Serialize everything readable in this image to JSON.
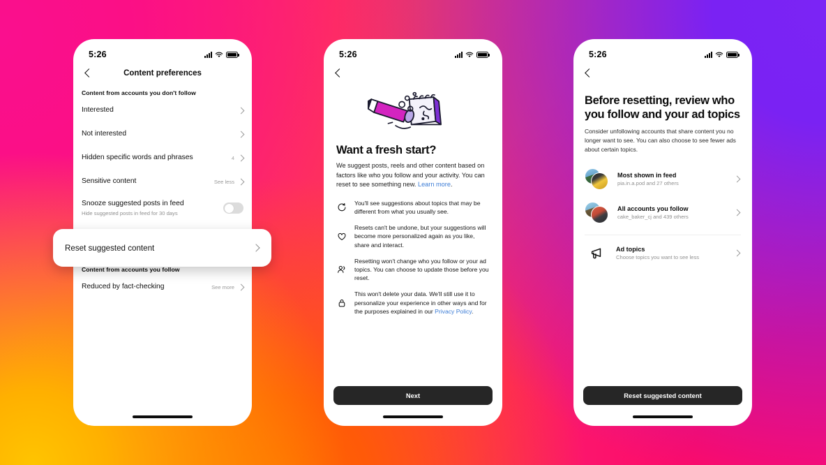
{
  "background": {
    "gradient_colors": [
      "#fa0f8e",
      "#7b24f5",
      "#ff0a6e",
      "#ff6a00",
      "#ffc400"
    ]
  },
  "phones": {
    "phone1": {
      "name": "content-preferences-screen",
      "status_bar": {
        "time": "5:26",
        "cellular": "cellular-icon",
        "wifi": "wifi-icon",
        "battery": "battery-icon"
      },
      "nav": {
        "back": "back-icon",
        "title": "Content preferences"
      },
      "section1_header": "Content from accounts you don't follow",
      "rows": [
        {
          "title": "Interested",
          "meta": "",
          "count": ""
        },
        {
          "title": "Not interested",
          "meta": "",
          "count": ""
        },
        {
          "title": "Hidden specific words and phrases",
          "meta": "",
          "count": "4"
        },
        {
          "title": "Sensitive content",
          "meta": "See less",
          "count": ""
        }
      ],
      "snooze": {
        "title": "Snooze suggested posts in feed",
        "subtitle": "Hide suggested posts in feed for 30 days",
        "toggle_state": "off"
      },
      "highlight": {
        "label": "Reset suggested content",
        "chevron": "chevron-right-icon"
      },
      "section2_header": "Content from accounts you follow",
      "rows2": [
        {
          "title": "Reduced by fact-checking",
          "meta": "See more",
          "count": ""
        }
      ]
    },
    "phone2": {
      "name": "fresh-start-screen",
      "status_bar": {
        "time": "5:26"
      },
      "nav": {
        "back": "back-icon"
      },
      "illustration": "pencil-eraser-notebook-illustration",
      "heading": "Want a fresh start?",
      "paragraph": "We suggest posts, reels and other content based on factors like who you follow and your activity. You can reset to see something new. ",
      "paragraph_link": "Learn more",
      "paragraph_end": ".",
      "bullets": [
        {
          "icon": "refresh-icon",
          "text": "You'll see suggestions about topics that may be different from what you usually see."
        },
        {
          "icon": "heart-icon",
          "text": "Resets can't be undone, but your suggestions will become more personalized again as you like, share and interact."
        },
        {
          "icon": "people-icon",
          "text": "Resetting won't change who you follow or your ad topics. You can choose to update those before you reset."
        },
        {
          "icon": "lock-icon",
          "text": "This won't delete your data. We'll still use it to personalize your experience in other ways and for the purposes explained in our ",
          "link": "Privacy Policy",
          "text_end": "."
        }
      ],
      "cta_label": "Next"
    },
    "phone3": {
      "name": "review-before-reset-screen",
      "status_bar": {
        "time": "5:26"
      },
      "nav": {
        "back": "back-icon"
      },
      "heading": "Before resetting, review who you follow and your ad topics",
      "paragraph": "Consider unfollowing accounts that share content you no longer want to see. You can also choose to see fewer ads about certain topics.",
      "items": [
        {
          "icon": "avatar-stack",
          "title": "Most shown in feed",
          "subtitle": "pia.in.a.pod and 27 others"
        },
        {
          "icon": "avatar-stack",
          "title": "All accounts you follow",
          "subtitle": "cake_baker_cj and 439 others"
        }
      ],
      "topic_item": {
        "icon": "megaphone-icon",
        "title": "Ad topics",
        "subtitle": "Choose topics you want to see less"
      },
      "cta_label": "Reset suggested content"
    }
  }
}
